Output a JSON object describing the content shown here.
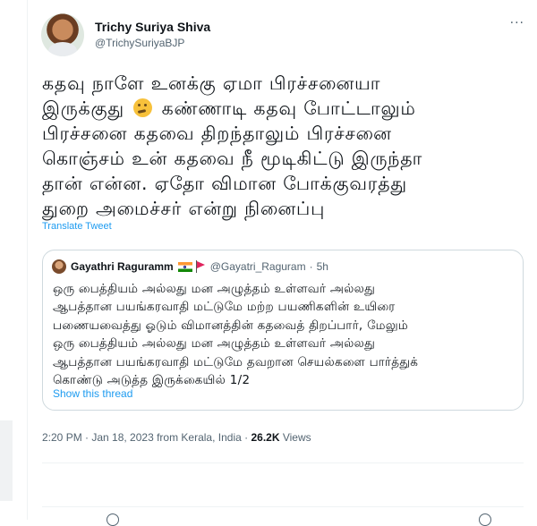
{
  "tweet": {
    "author_name": "Trichy Suriya Shiva",
    "author_handle": "@TrichySuriyaBJP",
    "more_label": "···",
    "text_lines": [
      "கதவு நாளே உனக்கு ஏமா பிரச்சனையா",
      "இருக்குது",
      "கண்ணாடி கதவு போட்டாலும்",
      "பிரச்சனை கதவை திறந்தாலும் பிரச்சனை",
      "கொஞ்சம் உன் கதவை நீ மூடிகிட்டு இருந்தா",
      "தான் என்ன. ஏதோ விமான போக்குவரத்து",
      "துறை அமைச்சர் என்று நினைப்பு"
    ],
    "emoji_icon": "thinking-face-emoji",
    "translate_label": "Translate Tweet",
    "timestamp": "2:20 PM · Jan 18, 2023 from Kerala, India · ",
    "views_count": "26.2K",
    "views_label": " Views"
  },
  "quote": {
    "author_name": "Gayathri Raguramm",
    "flags": [
      "india-flag-icon",
      "red-flag-icon"
    ],
    "author_handle": "@Gayatri_Raguram",
    "separator": "·",
    "time": "5h",
    "text_lines": [
      "ஒரு பைத்தியம் அல்லது மன அழுத்தம் உள்ளவர் அல்லது",
      "ஆபத்தான பயங்கரவாதி மட்டுமே மற்ற பயணிகளின் உயிரை",
      "பணையவைத்து ஓடும் விமானத்தின் கதவைத் திறப்பார், மேலும்",
      "ஒரு பைத்தியம் அல்லது மன அழுத்தம் உள்ளவர் அல்லது",
      "ஆபத்தான பயங்கரவாதி மட்டுமே தவறான செயல்களை பார்த்துக்",
      "கொண்டு அடுத்த இருக்கையில் 1/2"
    ],
    "show_thread_label": "Show this thread"
  },
  "colors": {
    "link": "#1d9bf0",
    "secondary_text": "#536471",
    "border": "#cfd9de"
  }
}
